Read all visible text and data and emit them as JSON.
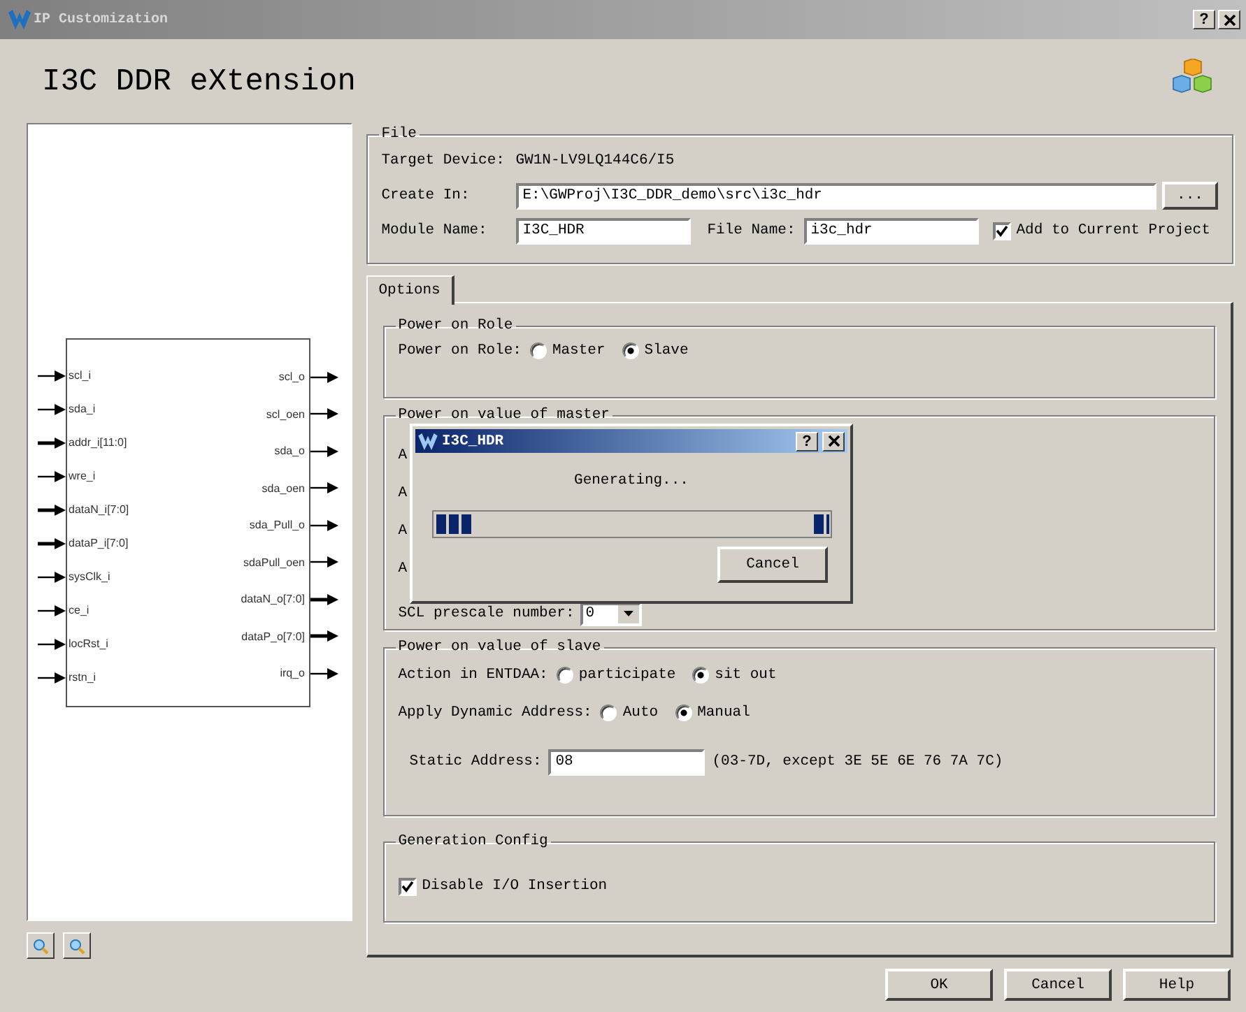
{
  "window": {
    "title": "IP Customization",
    "help_button": "?"
  },
  "heading": "I3C DDR eXtension",
  "symbol": {
    "inputs": [
      {
        "name": "scl_i",
        "bus": false
      },
      {
        "name": "sda_i",
        "bus": false
      },
      {
        "name": "addr_i[11:0]",
        "bus": true
      },
      {
        "name": "wre_i",
        "bus": false
      },
      {
        "name": "dataN_i[7:0]",
        "bus": true
      },
      {
        "name": "dataP_i[7:0]",
        "bus": true
      },
      {
        "name": "sysClk_i",
        "bus": false
      },
      {
        "name": "ce_i",
        "bus": false
      },
      {
        "name": "locRst_i",
        "bus": false
      },
      {
        "name": "rstn_i",
        "bus": false
      }
    ],
    "outputs": [
      {
        "name": "scl_o",
        "bus": false
      },
      {
        "name": "scl_oen",
        "bus": false
      },
      {
        "name": "sda_o",
        "bus": false
      },
      {
        "name": "sda_oen",
        "bus": false
      },
      {
        "name": "sda_Pull_o",
        "bus": false
      },
      {
        "name": "sdaPull_oen",
        "bus": false
      },
      {
        "name": "dataN_o[7:0]",
        "bus": true
      },
      {
        "name": "dataP_o[7:0]",
        "bus": true
      },
      {
        "name": "irq_o",
        "bus": false
      }
    ]
  },
  "file": {
    "legend": "File",
    "target_label": "Target Device:",
    "target_value": "GW1N-LV9LQ144C6/I5",
    "create_in_label": "Create In:",
    "create_in_value": "E:\\GWProj\\I3C_DDR_demo\\src\\i3c_hdr",
    "browse_button": "...",
    "module_label": "Module Name:",
    "module_value": "I3C_HDR",
    "file_label": "File Name:",
    "file_value": "i3c_hdr",
    "add_label": "Add to Current Project",
    "add_checked": true
  },
  "tabs": [
    {
      "label": "Options",
      "selected": true
    }
  ],
  "role": {
    "legend": "Power on Role",
    "label": "Power on Role:",
    "options": [
      {
        "label": "Master",
        "selected": false
      },
      {
        "label": "Slave",
        "selected": true
      }
    ]
  },
  "master": {
    "legend": "Power on value of master",
    "rows": [
      "A",
      "A",
      "A",
      "A"
    ],
    "prescale_label": "SCL prescale number:",
    "prescale_value": "0"
  },
  "slave": {
    "legend": "Power on value of slave",
    "entdaa": {
      "label": "Action in ENTDAA:",
      "options": [
        {
          "label": "participate",
          "selected": false
        },
        {
          "label": "sit out",
          "selected": true
        }
      ]
    },
    "dynamic": {
      "label": "Apply Dynamic Address:",
      "options": [
        {
          "label": "Auto",
          "selected": false
        },
        {
          "label": "Manual",
          "selected": true
        }
      ]
    },
    "static_label": "Static Address:",
    "static_value": "08",
    "static_hint": "(03-7D, except 3E 5E 6E 76 7A 7C)"
  },
  "generation": {
    "legend": "Generation Config",
    "label": "Disable I/O Insertion",
    "checked": true
  },
  "dialog": {
    "title": "I3C_HDR",
    "help_button": "?",
    "message": "Generating...",
    "busy": true,
    "cancel": "Cancel"
  },
  "buttons": [
    "OK",
    "Cancel",
    "Help"
  ]
}
